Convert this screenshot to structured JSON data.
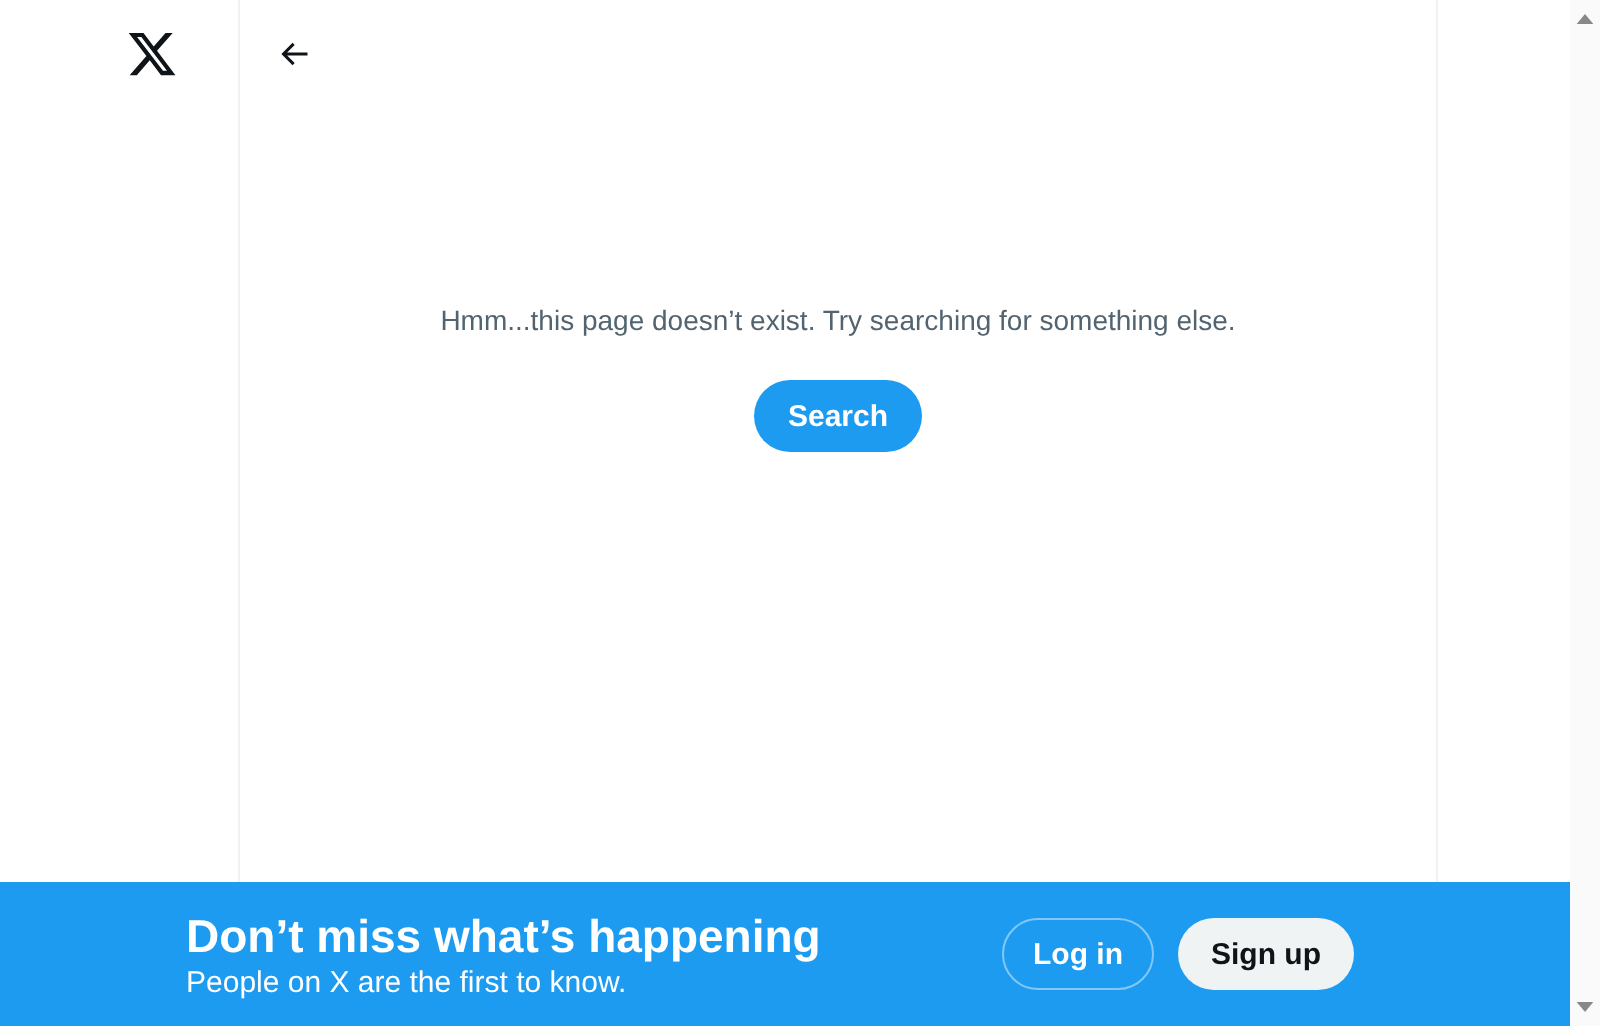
{
  "message": "Hmm...this page doesn’t exist. Try searching for something else.",
  "search_button": "Search",
  "banner": {
    "headline": "Don’t miss what’s happening",
    "subtitle": "People on X are the first to know.",
    "login_button": "Log in",
    "signup_button": "Sign up"
  }
}
